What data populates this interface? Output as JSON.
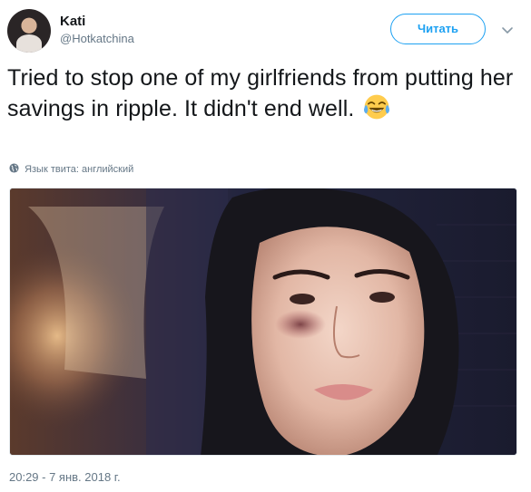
{
  "user": {
    "display_name": "Kati",
    "handle": "@Hotkatchina",
    "avatar_icon": "profile-photo"
  },
  "actions": {
    "follow_label": "Читать",
    "more_icon": "chevron-down-icon"
  },
  "tweet": {
    "text": "Tried to stop one of my girlfriends from putting her savings in ripple. It didn't end well.",
    "emoji": "face-with-tears-of-joy",
    "language_note": "Язык твита: английский",
    "timestamp": "20:29 - 7 янв. 2018 г."
  },
  "colors": {
    "accent": "#1da1f2",
    "secondary_text": "#657786",
    "primary_text": "#14171a"
  }
}
